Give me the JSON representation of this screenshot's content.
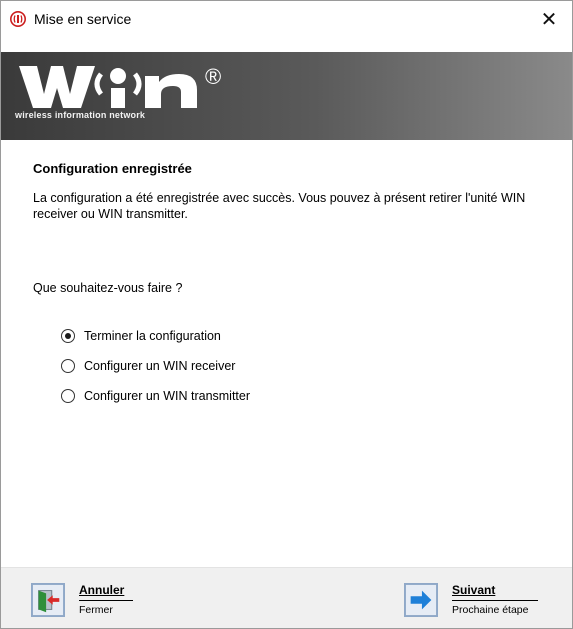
{
  "window": {
    "title": "Mise en service",
    "close_symbol": "✕",
    "app_icon": "red-antenna-icon"
  },
  "banner": {
    "logo_text": "WIN",
    "registered": "®",
    "tagline": "wireless information network"
  },
  "content": {
    "heading": "Configuration enregistrée",
    "description": "La configuration a été enregistrée avec succès. Vous pouvez à présent retirer l'unité WIN receiver ou WIN transmitter.",
    "question": "Que souhaitez-vous faire ?"
  },
  "options": [
    {
      "label": "Terminer la configuration",
      "selected": true
    },
    {
      "label": "Configurer un WIN receiver",
      "selected": false
    },
    {
      "label": "Configurer un WIN transmitter",
      "selected": false
    }
  ],
  "footer": {
    "cancel": {
      "label": "Annuler",
      "sub": "Fermer",
      "icon": "exit-door-icon"
    },
    "next": {
      "label": "Suivant",
      "sub": "Prochaine étape",
      "icon": "arrow-right-icon"
    }
  },
  "colors": {
    "accent_red": "#cc1f1f",
    "arrow_blue": "#1e7fd8",
    "banner_dark": "#3a3a3a"
  }
}
